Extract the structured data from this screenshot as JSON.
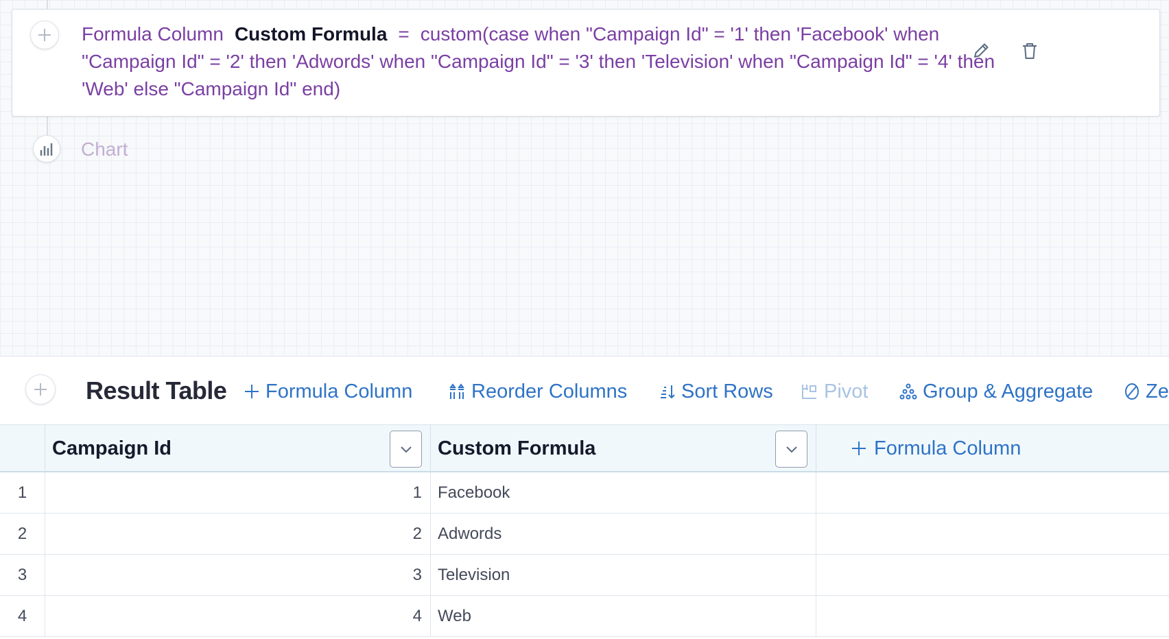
{
  "step": {
    "type_label": "Formula Column",
    "output_name": "Custom Formula",
    "equals": "=",
    "formula": "custom(case when \"Campaign Id\" = '1' then 'Facebook' when \"Campaign Id\" = '2' then 'Adwords' when \"Campaign Id\" = '3' then 'Television' when \"Campaign Id\" = '4' then 'Web' else \"Campaign Id\" end)"
  },
  "next_step": {
    "label": "Chart"
  },
  "toolbar": {
    "title": "Result Table",
    "actions": [
      {
        "label": "Formula Column",
        "icon": "plus-icon",
        "enabled": true
      },
      {
        "label": "Reorder Columns",
        "icon": "reorder-columns-icon",
        "enabled": true
      },
      {
        "label": "Sort Rows",
        "icon": "sort-rows-icon",
        "enabled": true
      },
      {
        "label": "Pivot",
        "icon": "pivot-icon",
        "enabled": false
      },
      {
        "label": "Group & Aggregate",
        "icon": "group-aggregate-icon",
        "enabled": true
      },
      {
        "label": "Ze",
        "icon": "zero-icon",
        "enabled": true
      }
    ]
  },
  "table": {
    "columns": [
      "Campaign Id",
      "Custom Formula"
    ],
    "add_column_label": "Formula Column",
    "rows": [
      {
        "index": "1",
        "campaign_id": "1",
        "custom_formula": "Facebook"
      },
      {
        "index": "2",
        "campaign_id": "2",
        "custom_formula": "Adwords"
      },
      {
        "index": "3",
        "campaign_id": "3",
        "custom_formula": "Television"
      },
      {
        "index": "4",
        "campaign_id": "4",
        "custom_formula": "Web"
      }
    ]
  },
  "colors": {
    "formula_text": "#7a3fa3",
    "link_blue": "#2e73c6",
    "header_bg": "#f1f8fc"
  }
}
